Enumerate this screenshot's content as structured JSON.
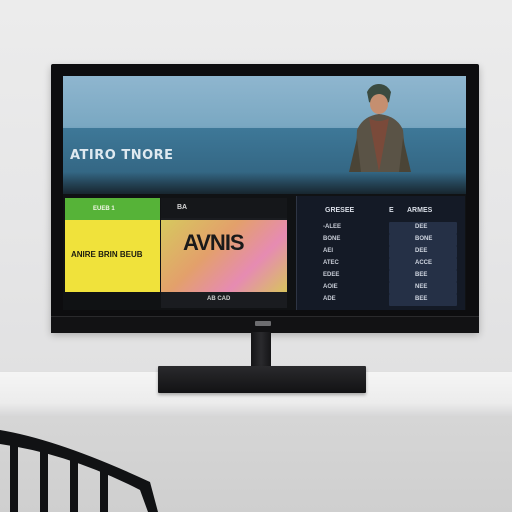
{
  "scene": {
    "subject": "tv-on-shelf"
  },
  "screen": {
    "hero_title": "ATIRO TNORE",
    "yellow_tile_top": "EUEB 1",
    "yellow_tile_text": "ANIRE BRIN BEUB",
    "photo_tile_top": "BA",
    "photo_tile_word": "AVNIS",
    "photo_tile_caption": "AB CAD",
    "list_header_left": "GRESEE",
    "list_header_mid": "E",
    "list_header_right": "ARMES",
    "rows_left": [
      "-ALEE",
      "BONE",
      "AEI",
      "ATEC",
      "EDEE",
      "AOIE",
      "ADE"
    ],
    "rows_right": [
      "DEE",
      "BONE",
      "DEE",
      "ACCE",
      "BEE",
      "NEE",
      "BEE"
    ],
    "tv_logo_text": ""
  }
}
